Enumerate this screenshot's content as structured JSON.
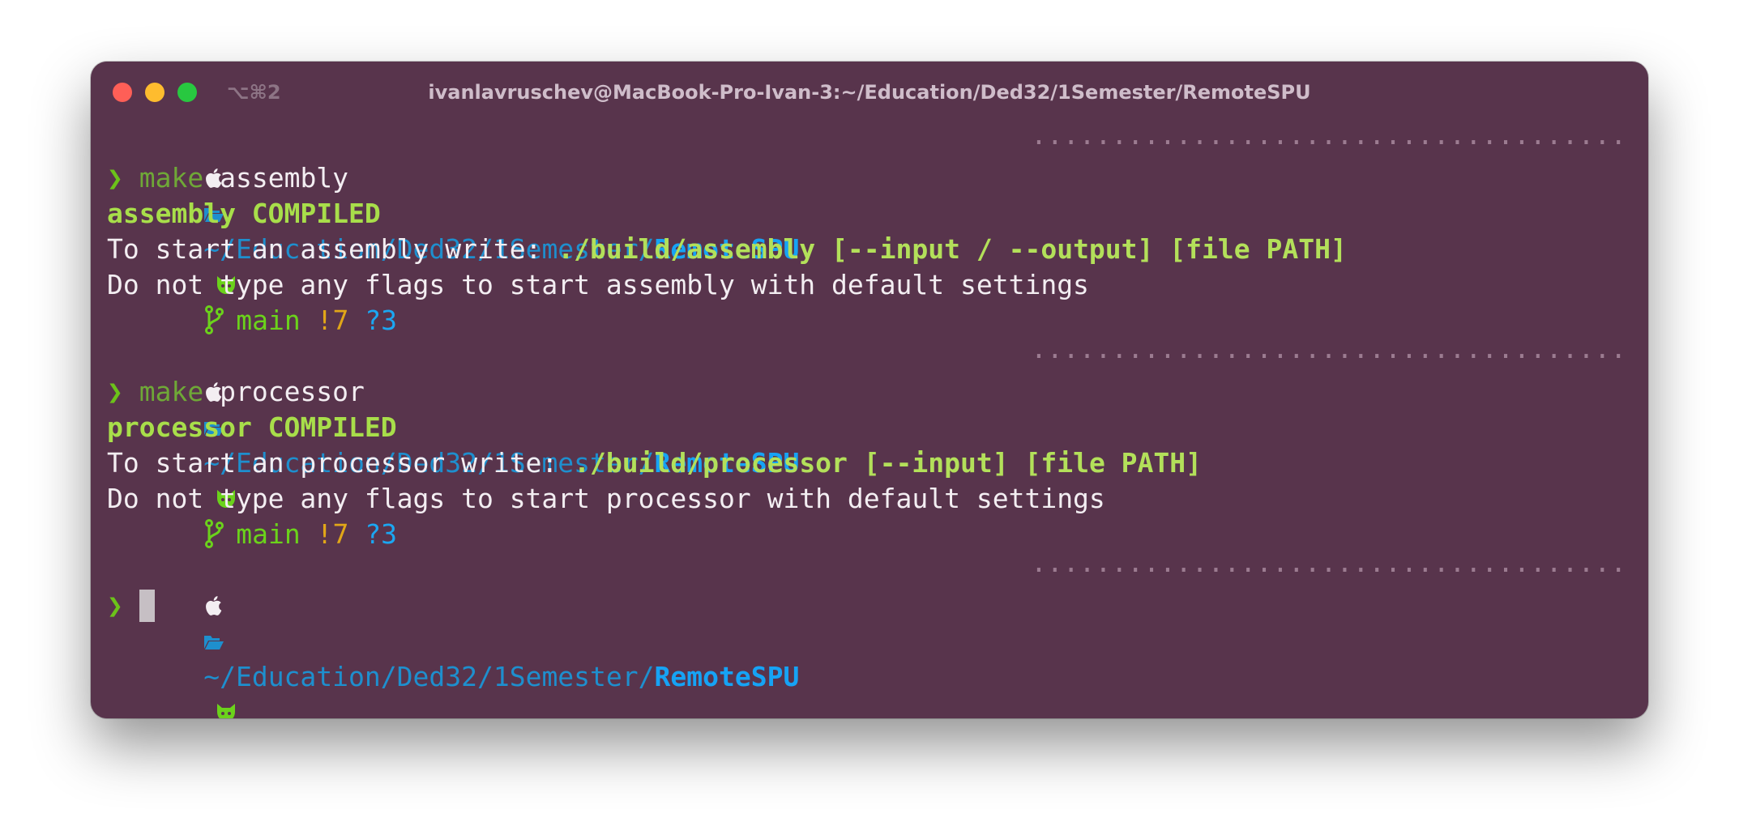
{
  "window": {
    "shortcut": "⌥⌘2",
    "title": "ivanlavruschev@MacBook-Pro-Ivan-3:~/Education/Ded32/1Semester/RemoteSPU"
  },
  "prompt": {
    "path_prefix": "~/Education/Ded32/1Semester/",
    "path_dir": "RemoteSPU",
    "branch": "main",
    "modified": "!7",
    "untracked": "?3",
    "dots": "······························································"
  },
  "blocks": [
    {
      "chevron": "❯",
      "cmd_keyword": "make",
      "cmd_arg": " assembly",
      "compiled": "assembly COMPILED",
      "usage_prefix": "To start an assembly write: ",
      "usage_cmd": "./build/assembly [--input / --output] [file PATH]",
      "hint": "Do not type any flags to start assembly with default settings"
    },
    {
      "chevron": "❯",
      "cmd_keyword": "make",
      "cmd_arg": " processor",
      "compiled": "processor COMPILED",
      "usage_prefix": "To start an processor write: ",
      "usage_cmd": "./build/processor [--input] [file PATH]",
      "hint": "Do not type any flags to start processor with default settings"
    }
  ],
  "final_prompt": {
    "chevron": "❯"
  },
  "colors": {
    "background": "#58344c",
    "path": "#1e8fce",
    "branch": "#6bd21b",
    "modified": "#e1a618",
    "untracked": "#1ba7f2",
    "success": "#a8de4a"
  }
}
